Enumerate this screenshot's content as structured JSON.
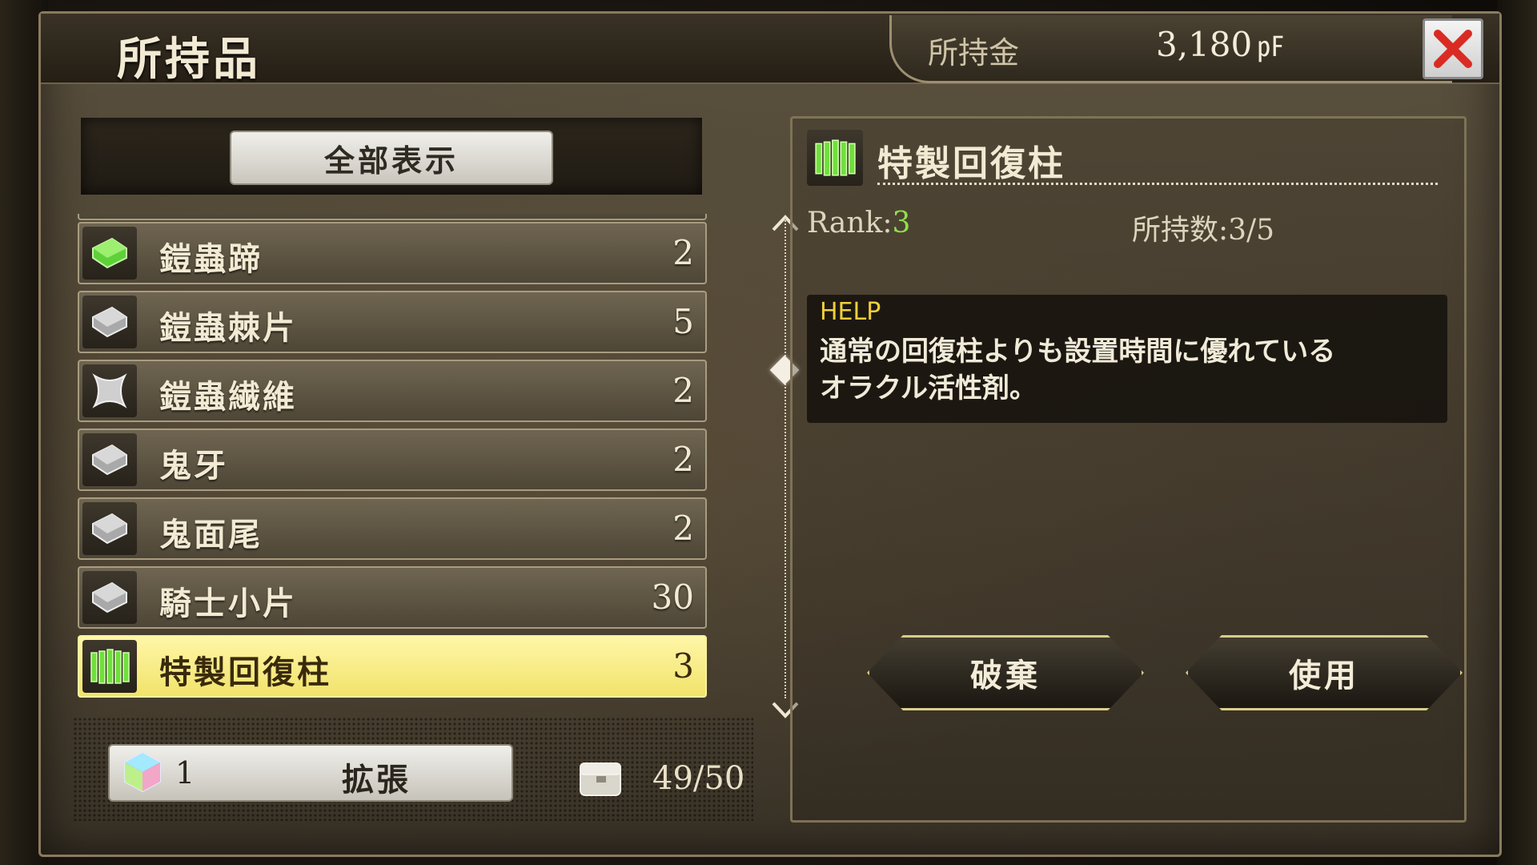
{
  "window": {
    "title": "所持品",
    "money_label": "所持金",
    "money_value": "3,180",
    "money_unit": "㎊",
    "close_icon": "close-icon"
  },
  "list": {
    "show_all_label": "全部表示",
    "items": [
      {
        "name": "鎧蟲蹄",
        "count": "2",
        "icon": "green-ingot-icon"
      },
      {
        "name": "鎧蟲棘片",
        "count": "5",
        "icon": "silver-ingot-icon"
      },
      {
        "name": "鎧蟲繊維",
        "count": "2",
        "icon": "fiber-icon"
      },
      {
        "name": "鬼牙",
        "count": "2",
        "icon": "silver-ingot-icon"
      },
      {
        "name": "鬼面尾",
        "count": "2",
        "icon": "silver-ingot-icon"
      },
      {
        "name": "騎士小片",
        "count": "30",
        "icon": "silver-ingot-icon"
      },
      {
        "name": "特製回復柱",
        "count": "3",
        "icon": "recovery-pillar-icon",
        "selected": true
      }
    ]
  },
  "bottom": {
    "gem_count": "1",
    "expand_label": "拡張",
    "capacity": "49/50"
  },
  "detail": {
    "name": "特製回復柱",
    "rank_label": "Rank:",
    "rank_value": "3",
    "owned": "所持数:3/5",
    "help_title": "HELP",
    "help_line1": "通常の回復柱よりも設置時間に優れている",
    "help_line2": "オラクル活性剤。",
    "discard_label": "破棄",
    "use_label": "使用"
  },
  "colors": {
    "accent_green": "#8fe04a",
    "selected_row": "#f1e36a",
    "help_title": "#f0cf3a"
  }
}
